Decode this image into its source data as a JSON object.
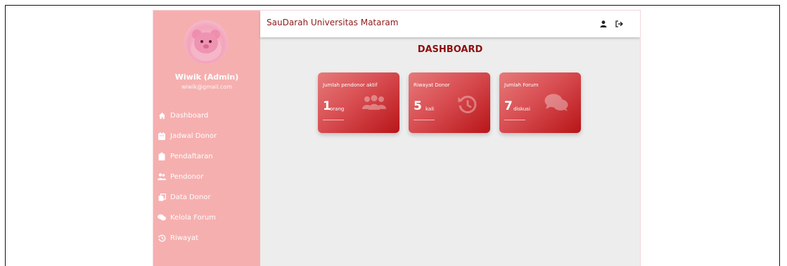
{
  "app": {
    "brand": "SauDarah Universitas Mataram"
  },
  "user": {
    "name": "Wiwik (Admin)",
    "email": "wiwik@gmail.com"
  },
  "sidebar": {
    "items": [
      {
        "label": "Dashboard",
        "icon": "home-icon"
      },
      {
        "label": "Jadwal Donor",
        "icon": "calendar-icon"
      },
      {
        "label": "Pendaftaran",
        "icon": "clipboard-icon"
      },
      {
        "label": "Pendonor",
        "icon": "users-icon"
      },
      {
        "label": "Data Donor",
        "icon": "copy-icon"
      },
      {
        "label": "Kelola Forum",
        "icon": "comments-icon"
      },
      {
        "label": "Riwayat",
        "icon": "history-icon"
      }
    ]
  },
  "topbar": {
    "profile_icon": "user-icon",
    "logout_icon": "logout-icon"
  },
  "main": {
    "title": "DASHBOARD",
    "cards": [
      {
        "label": "Jumlah pendonor aktif",
        "value": "1",
        "unit": "orang",
        "icon": "users-icon"
      },
      {
        "label": "Riwayat Donor",
        "value": "5",
        "unit": "kali",
        "icon": "history-icon"
      },
      {
        "label": "Jumlah Forum",
        "value": "7",
        "unit": "diskusi",
        "icon": "comments-icon"
      }
    ]
  },
  "colors": {
    "sidebar": "#f6afaf",
    "accent": "#8e1a1a",
    "card_start": "#e67a7a",
    "card_end": "#b81518"
  }
}
